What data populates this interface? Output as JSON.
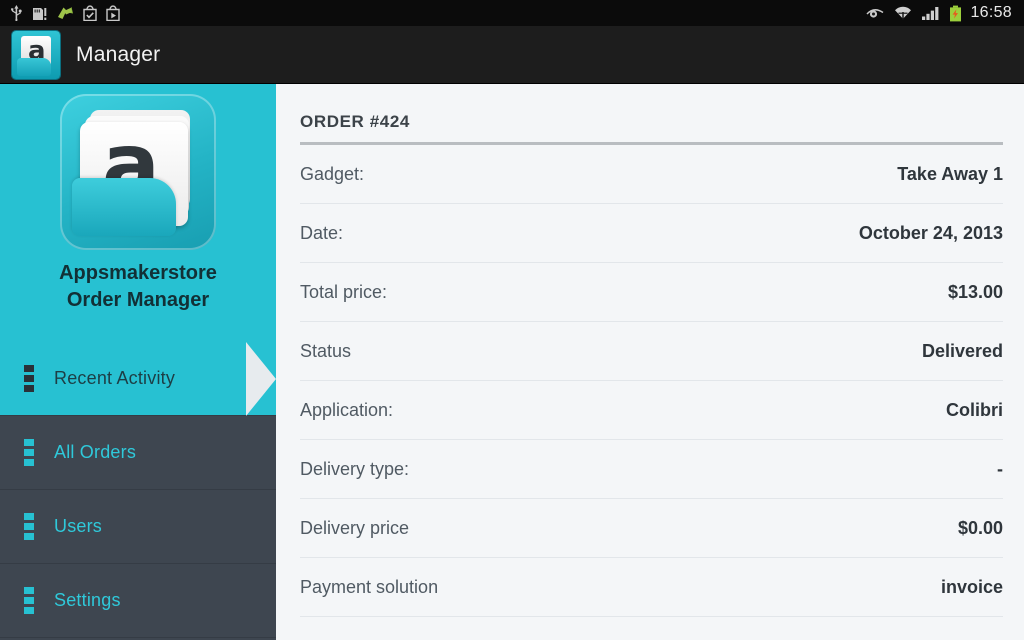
{
  "statusbar": {
    "icons_left": [
      "usb-icon",
      "sdcard-warning-icon",
      "download-arrow-icon",
      "play-store-check-icon",
      "play-store-play-icon"
    ],
    "icons_right": [
      "eye-icon",
      "wifi-icon",
      "cellular-signal-icon",
      "battery-charging-icon"
    ],
    "clock": "16:58"
  },
  "titlebar": {
    "app_icon": "appsmakerstore-logo-icon",
    "title": "Manager"
  },
  "sidebar": {
    "brand_icon": "appsmakerstore-logo-icon",
    "brand_line1": "Appsmakerstore",
    "brand_line2": "Order Manager",
    "accent_color": "#27c1d2",
    "background_color": "#3e4650",
    "items": [
      {
        "label": "Recent Activity",
        "active": true
      },
      {
        "label": "All Orders",
        "active": false
      },
      {
        "label": "Users",
        "active": false
      },
      {
        "label": "Settings",
        "active": false
      }
    ]
  },
  "content": {
    "heading": "ORDER #424",
    "rows": [
      {
        "label": "Gadget:",
        "value": "Take Away 1"
      },
      {
        "label": "Date:",
        "value": "October 24, 2013"
      },
      {
        "label": "Total price:",
        "value": "$13.00"
      },
      {
        "label": "Status",
        "value": "Delivered"
      },
      {
        "label": "Application:",
        "value": "Colibri"
      },
      {
        "label": "Delivery type:",
        "value": "-"
      },
      {
        "label": "Delivery price",
        "value": "$0.00"
      },
      {
        "label": "Payment solution",
        "value": "invoice"
      }
    ]
  }
}
